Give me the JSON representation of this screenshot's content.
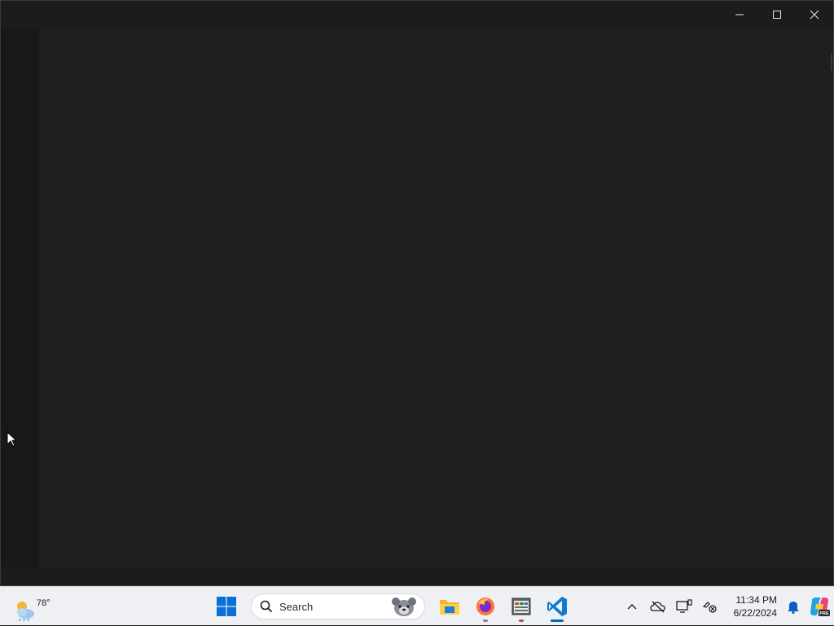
{
  "window": {
    "controls": {
      "minimize_icon": "minimize-icon",
      "maximize_icon": "maximize-icon",
      "close_icon": "close-icon"
    }
  },
  "taskbar": {
    "weather": {
      "temperature": "78°",
      "icon": "partly-cloudy-icon"
    },
    "start_icon": "windows-start-icon",
    "search": {
      "placeholder": "Search",
      "icon": "search-icon"
    },
    "pinned": [
      {
        "name": "file-explorer",
        "icon": "folder-icon",
        "running": false
      },
      {
        "name": "firefox",
        "icon": "firefox-icon",
        "running": true
      },
      {
        "name": "task-app",
        "icon": "app-window-icon",
        "running": true
      },
      {
        "name": "vscode",
        "icon": "vscode-icon",
        "running": true,
        "active": true
      }
    ],
    "tray": {
      "overflow_icon": "chevron-up-icon",
      "icons": [
        "cloud-off-icon",
        "device-icon",
        "network-icon"
      ],
      "time": "11:34 PM",
      "date": "6/22/2024",
      "notification_icon": "bell-icon",
      "copilot_icon": "copilot-icon",
      "copilot_badge": "PRE"
    }
  },
  "colors": {
    "editor_bg": "#1f1f1f",
    "activity_bar_bg": "#181818",
    "taskbar_bg": "#eef0f4",
    "accent": "#0067c0"
  }
}
